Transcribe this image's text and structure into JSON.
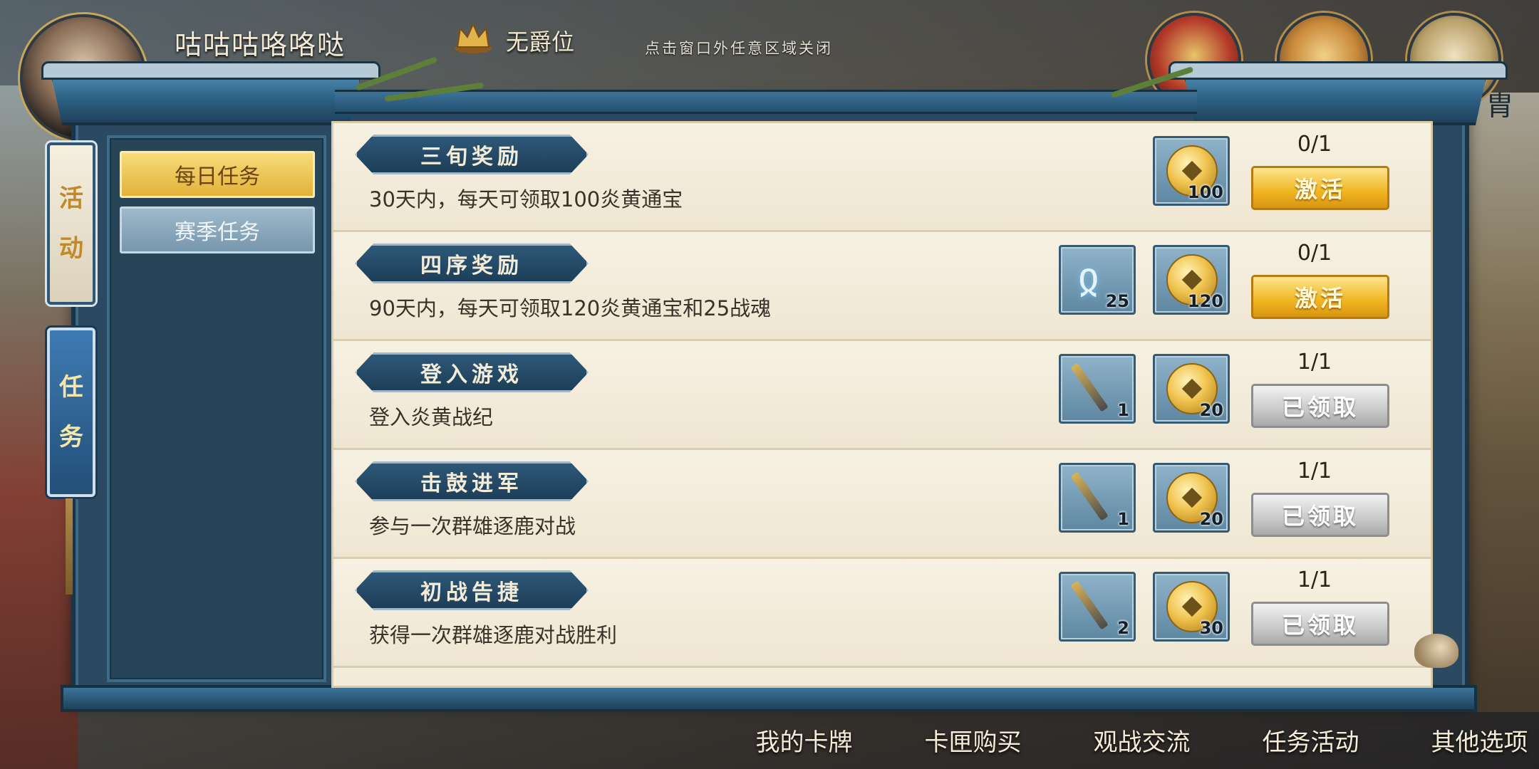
{
  "player": {
    "name": "咕咕咕咯咯哒",
    "rank": "无爵位"
  },
  "hint": "点击窗口外任意区域关闭",
  "partial_label": "胄",
  "side_tabs": [
    {
      "label": [
        "活",
        "动"
      ]
    },
    {
      "label": [
        "任",
        "务"
      ]
    }
  ],
  "side_tab_labels": {
    "activity_1": "活",
    "activity_2": "动",
    "task_1": "任",
    "task_2": "务"
  },
  "submenu": {
    "daily": "每日任务",
    "season": "赛季任务"
  },
  "tasks": [
    {
      "title": "三旬奖励",
      "desc": "30天内，每天可领取100炎黄通宝",
      "progress": "0/1",
      "action": "激活",
      "rewards": [
        {
          "icon": "coin-icon",
          "qty": "100"
        }
      ]
    },
    {
      "title": "四序奖励",
      "desc": "90天内，每天可领取120炎黄通宝和25战魂",
      "progress": "0/1",
      "action": "激活",
      "rewards": [
        {
          "icon": "soul-icon",
          "qty": "25"
        },
        {
          "icon": "coin-icon",
          "qty": "120"
        }
      ]
    },
    {
      "title": "登入游戏",
      "desc": "登入炎黄战纪",
      "progress": "1/1",
      "action": "已领取",
      "rewards": [
        {
          "icon": "sword-icon",
          "qty": "1"
        },
        {
          "icon": "coin-icon",
          "qty": "20"
        }
      ]
    },
    {
      "title": "击鼓进军",
      "desc": "参与一次群雄逐鹿对战",
      "progress": "1/1",
      "action": "已领取",
      "rewards": [
        {
          "icon": "sword-icon",
          "qty": "1"
        },
        {
          "icon": "coin-icon",
          "qty": "20"
        }
      ]
    },
    {
      "title": "初战告捷",
      "desc": "获得一次群雄逐鹿对战胜利",
      "progress": "1/1",
      "action": "已领取",
      "rewards": [
        {
          "icon": "sword-icon",
          "qty": "2"
        },
        {
          "icon": "coin-icon",
          "qty": "30"
        }
      ]
    }
  ],
  "bottom_nav": [
    "我的卡牌",
    "卡匣购买",
    "观战交流",
    "任务活动",
    "其他选项"
  ],
  "colors": {
    "frame_blue": "#2b4a62",
    "gold_button": "#f0b521",
    "paper": "#f3ecdb"
  }
}
